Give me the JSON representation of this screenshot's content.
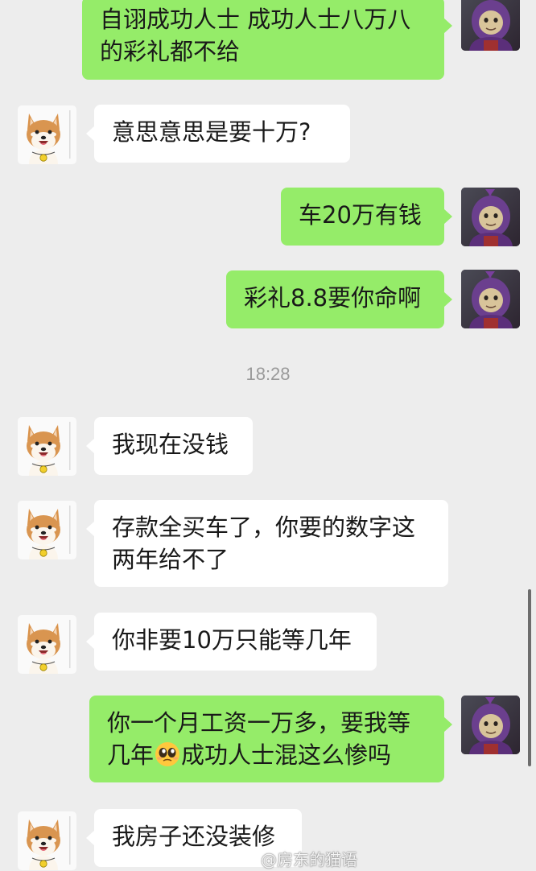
{
  "chat": {
    "messages": [
      {
        "from": "me",
        "lines": [
          "自诩成功人士 成功人士八万八",
          "的彩礼都不给"
        ]
      },
      {
        "from": "other",
        "lines": [
          "意思意思是要十万?"
        ]
      },
      {
        "from": "me",
        "lines": [
          "车20万有钱"
        ]
      },
      {
        "from": "me",
        "lines": [
          "彩礼8.8要你命啊"
        ]
      },
      {
        "from": "other",
        "lines": [
          "我现在没钱"
        ]
      },
      {
        "from": "other",
        "lines": [
          "存款全买车了，你要的数字这",
          "两年给不了"
        ]
      },
      {
        "from": "other",
        "lines": [
          "你非要10万只能等几年"
        ]
      },
      {
        "from": "me",
        "lines": [
          "你一个月工资一万多，要我等",
          "几年",
          "成功人士混这么惨吗"
        ],
        "emoji": "pleading-face-emoji"
      },
      {
        "from": "other",
        "lines": [
          "我房子还没装修"
        ]
      }
    ],
    "timestamp": "18:28"
  },
  "avatars": {
    "me": "teletubby-avatar",
    "other": "shiba-inu-avatar"
  },
  "watermark": {
    "icon": "weibo-icon",
    "text": "@房东的猫语"
  },
  "colors": {
    "background": "#ededed",
    "incoming_bubble": "#ffffff",
    "outgoing_bubble": "#95ec69",
    "timestamp_text": "#9a9a9a"
  }
}
